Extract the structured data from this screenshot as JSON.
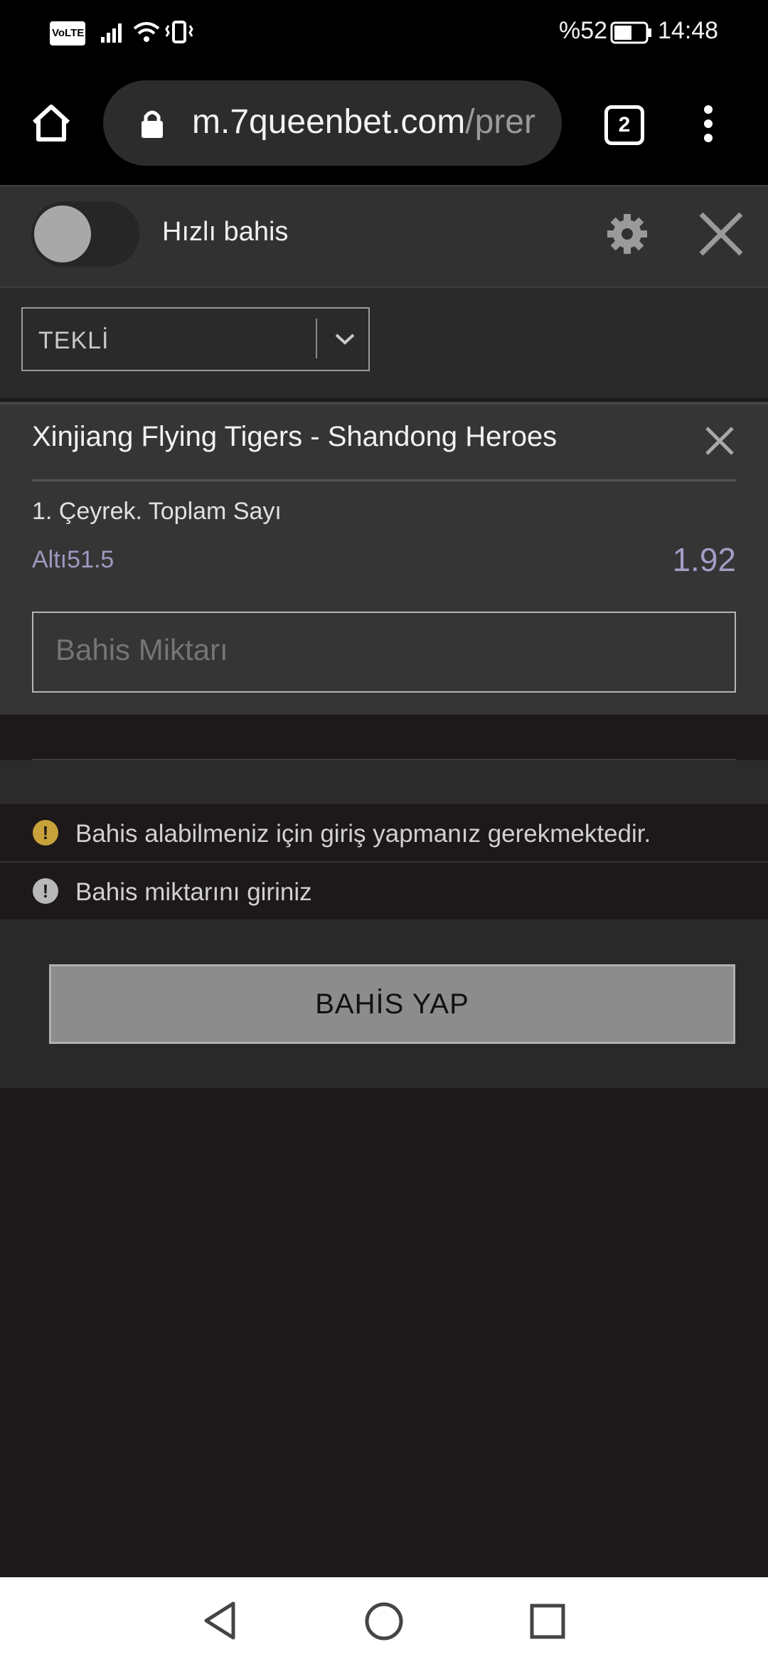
{
  "status_bar": {
    "volte": "VoLTE",
    "battery_percent": "%52",
    "time": "14:48"
  },
  "browser": {
    "url_domain": "m.7queenbet.com",
    "url_path": "/prer",
    "tab_count": "2"
  },
  "header": {
    "quick_bet_label": "Hızlı bahis",
    "quick_bet_enabled": false
  },
  "bet_type_select": {
    "selected": "TEKLİ"
  },
  "bet_card": {
    "match": "Xinjiang Flying Tigers - Shandong Heroes",
    "market": "1. Çeyrek. Toplam Sayı",
    "selection": "Altı51.5",
    "odds": "1.92",
    "stake_placeholder": "Bahis Miktarı"
  },
  "messages": [
    {
      "text": "Bahis alabilmeniz için giriş yapmanız gerekmektedir.",
      "icon": "warning-icon",
      "color": "#c9a23b"
    },
    {
      "text": "Bahis miktarını giriniz",
      "icon": "info-icon",
      "color": "#b8b8b8"
    }
  ],
  "place_bet_button": "BAHİS YAP",
  "colors": {
    "odds": "#a29dc5",
    "warning": "#c9a23b"
  }
}
